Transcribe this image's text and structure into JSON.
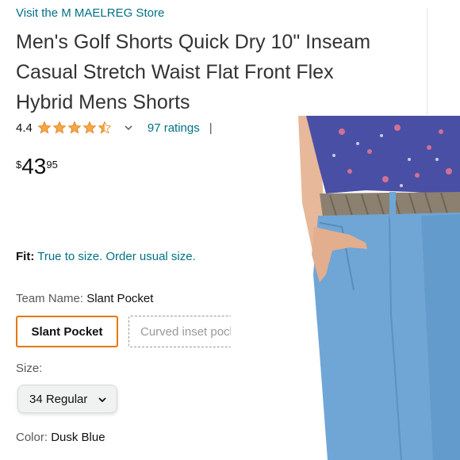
{
  "product": {
    "store_link": "Visit the M MAELREG Store",
    "title": "Men's Golf Shorts Quick Dry 10\" Inseam Casual Stretch Waist Flat Front Flex Hybrid Mens Shorts",
    "rating_value": "4.4",
    "rating_stars": 4.5,
    "ratings_count": "97 ratings",
    "separator": "|",
    "price": {
      "symbol": "$",
      "whole": "43",
      "fraction": "95"
    },
    "fit": {
      "label": "Fit:",
      "value": "True to size. Order usual size."
    },
    "team": {
      "label": "Team Name:",
      "value": "Slant Pocket",
      "options": [
        "Slant Pocket",
        "Curved inset pocket"
      ]
    },
    "size": {
      "label": "Size:",
      "value": "34 Regular"
    },
    "color": {
      "label": "Color:",
      "value": "Dusk Blue"
    }
  },
  "image": {
    "description": "model-wearing-shorts",
    "shorts_color": "#6FA6D6",
    "shirt_color": "#4A4FA6"
  },
  "colors": {
    "link": "#007185",
    "star": "#F3A847",
    "selected_border": "#E77600"
  }
}
